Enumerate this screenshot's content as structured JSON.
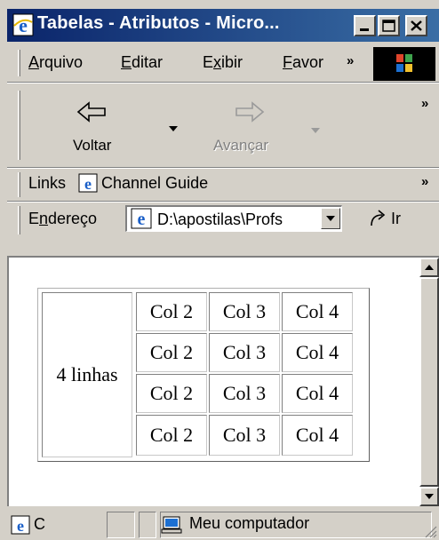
{
  "window": {
    "title": "Tabelas - Atributos - Micro..."
  },
  "menu": {
    "items": [
      {
        "label_pre": "",
        "accel": "A",
        "label_post": "rquivo"
      },
      {
        "label_pre": "",
        "accel": "E",
        "label_post": "ditar"
      },
      {
        "label_pre": "E",
        "accel": "x",
        "label_post": "ibir"
      },
      {
        "label_pre": "",
        "accel": "F",
        "label_post": "avor"
      }
    ],
    "chevron": "»"
  },
  "toolbar": {
    "back_label": "Voltar",
    "forward_label": "Avançar",
    "chevron": "»"
  },
  "links": {
    "label": "Links",
    "channel_guide": "Channel Guide",
    "chevron": "»"
  },
  "address": {
    "label_pre": "E",
    "accel": "n",
    "label_post": "dereço",
    "value": "D:\\apostilas\\Profs",
    "go_label": "Ir"
  },
  "table": {
    "rowspan_label": "4 linhas",
    "rows": [
      [
        "Col 2",
        "Col 3",
        "Col 4"
      ],
      [
        "Col 2",
        "Col 3",
        "Col 4"
      ],
      [
        "Col 2",
        "Col 3",
        "Col 4"
      ],
      [
        "Col 2",
        "Col 3",
        "Col 4"
      ]
    ]
  },
  "status": {
    "progress_text": "C",
    "zone": "Meu computador"
  },
  "colors": {
    "titlebar_start": "#0a246a",
    "titlebar_end": "#3a6ea5",
    "chrome": "#d4d0c8"
  }
}
